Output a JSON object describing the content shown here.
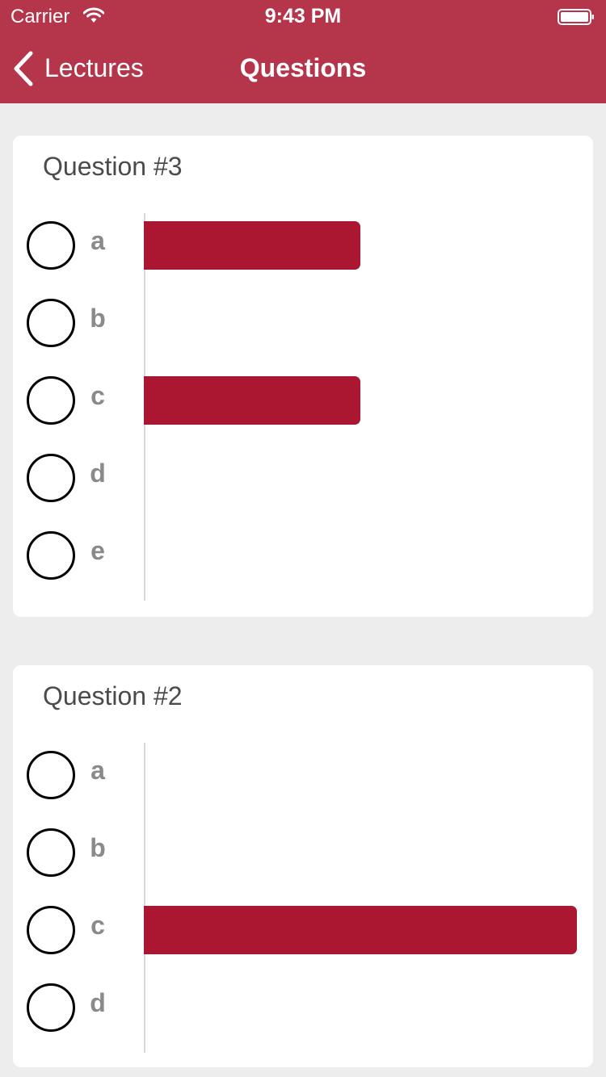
{
  "status_bar": {
    "carrier": "Carrier",
    "time": "9:43 PM"
  },
  "nav": {
    "back_label": "Lectures",
    "title": "Questions"
  },
  "colors": {
    "nav_bg": "#B5354B",
    "bar": "#AB1631",
    "page_bg": "#EDEDED"
  },
  "questions": [
    {
      "title": "Question #3",
      "options": [
        {
          "label": "a",
          "share": 0.5
        },
        {
          "label": "b",
          "share": 0
        },
        {
          "label": "c",
          "share": 0.5
        },
        {
          "label": "d",
          "share": 0
        },
        {
          "label": "e",
          "share": 0
        }
      ]
    },
    {
      "title": "Question #2",
      "options": [
        {
          "label": "a",
          "share": 0
        },
        {
          "label": "b",
          "share": 0
        },
        {
          "label": "c",
          "share": 1
        },
        {
          "label": "d",
          "share": 0
        }
      ]
    }
  ]
}
